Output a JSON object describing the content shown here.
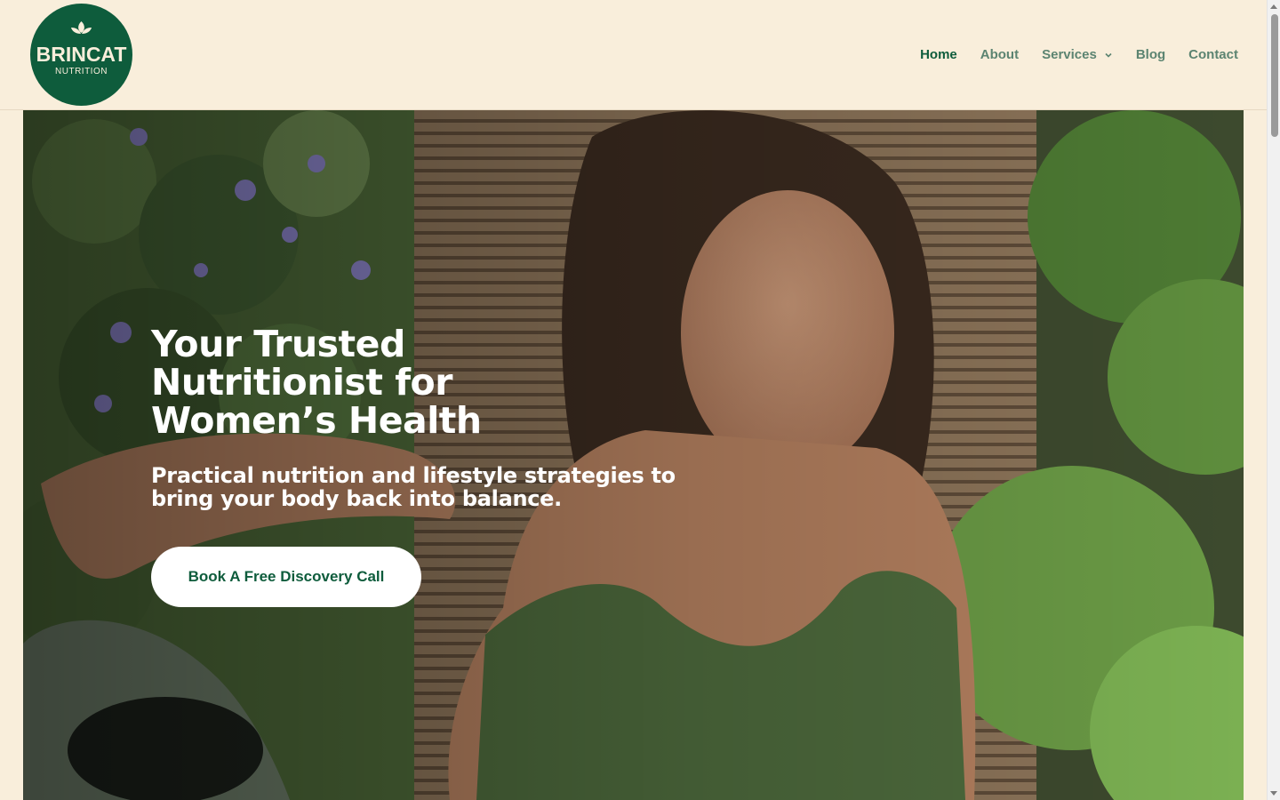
{
  "brand": {
    "name": "BRINCAT",
    "tagline": "NUTRITION",
    "primary_color": "#0e5c3c",
    "background_color": "#f9eedb"
  },
  "nav": {
    "items": [
      {
        "label": "Home",
        "active": true
      },
      {
        "label": "About",
        "active": false
      },
      {
        "label": "Services",
        "active": false,
        "has_dropdown": true,
        "icon": "chevron-down-icon"
      },
      {
        "label": "Blog",
        "active": false
      },
      {
        "label": "Contact",
        "active": false
      }
    ]
  },
  "hero": {
    "title": "Your Trusted Nutritionist for Women’s Health",
    "subtitle": "Practical nutrition and lifestyle strategies to bring your body back into balance.",
    "cta_label": "Book A Free Discovery Call"
  }
}
